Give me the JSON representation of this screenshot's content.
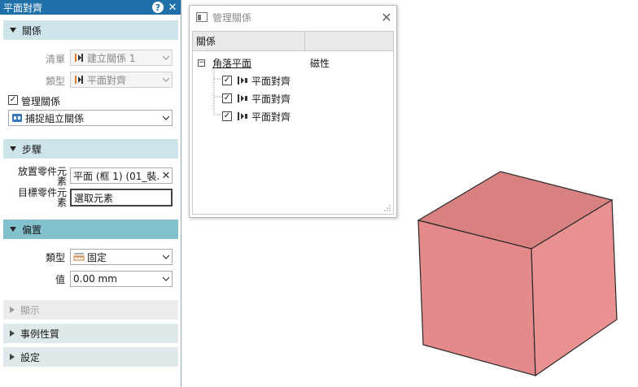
{
  "panel": {
    "title": "平面對齊",
    "help_icon": "question-icon",
    "sections": {
      "relation": {
        "header": "關係",
        "list_label": "清單",
        "list_value": "建立關係 1",
        "type_label": "類型",
        "type_value": "平面對齊",
        "manage_checkbox_label": "管理關係",
        "manage_checked": true,
        "capture_value": "捕捉組立關係"
      },
      "steps": {
        "header": "步驟",
        "place_label": "放置零件元素",
        "place_value": "平面 (框 1) (01_裝...",
        "target_label": "目標零件元素",
        "target_value": "選取元素"
      },
      "offset": {
        "header": "偏置",
        "type_label": "類型",
        "type_value": "固定",
        "value_label": "值",
        "value_value": "0.00 mm"
      },
      "display": {
        "header": "顯示"
      },
      "instance": {
        "header": "事例性質"
      },
      "settings": {
        "header": "設定"
      }
    }
  },
  "dialog": {
    "title": "管理關係",
    "col1": "關係",
    "col2": "",
    "root": {
      "label": "角落平面",
      "value": "磁性"
    },
    "children": [
      {
        "label": "平面對齊",
        "checked": true
      },
      {
        "label": "平面對齊",
        "checked": true
      },
      {
        "label": "平面對齊",
        "checked": true
      }
    ]
  },
  "colors": {
    "titlebar": "#1f6fa8",
    "section_active": "#84c1cf",
    "section": "#cde4ea",
    "cube_front": "#e48a8a",
    "cube_top": "#d98080",
    "cube_side": "#e99090"
  }
}
